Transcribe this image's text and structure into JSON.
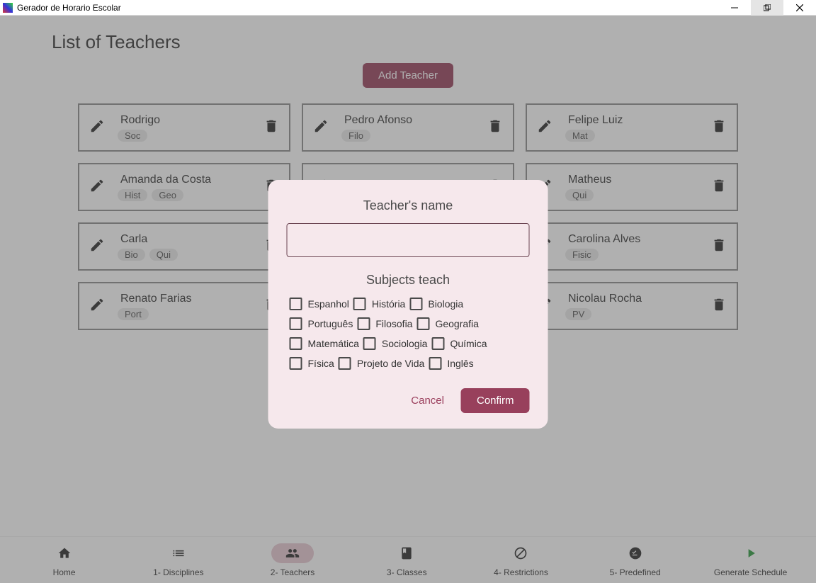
{
  "window": {
    "title": "Gerador de Horario Escolar"
  },
  "page": {
    "title": "List of Teachers",
    "add_teacher_label": "Add Teacher"
  },
  "teachers": [
    {
      "name": "Rodrigo",
      "tags": [
        "Soc"
      ]
    },
    {
      "name": "Pedro Afonso",
      "tags": [
        "Filo"
      ]
    },
    {
      "name": "Felipe Luiz",
      "tags": [
        "Mat"
      ]
    },
    {
      "name": "Amanda da Costa",
      "tags": [
        "Hist",
        "Geo"
      ]
    },
    {
      "name": "",
      "tags": []
    },
    {
      "name": "Matheus",
      "tags": [
        "Qui"
      ]
    },
    {
      "name": "Carla",
      "tags": [
        "Bio",
        "Qui"
      ]
    },
    {
      "name": "",
      "tags": []
    },
    {
      "name": "Carolina Alves",
      "tags": [
        "Fisic"
      ]
    },
    {
      "name": "Renato Farias",
      "tags": [
        "Port"
      ]
    },
    {
      "name": "",
      "tags": []
    },
    {
      "name": "Nicolau Rocha",
      "tags": [
        "PV"
      ]
    }
  ],
  "modal": {
    "name_label": "Teacher's name",
    "subjects_label": "Subjects teach",
    "name_value": "",
    "subjects": [
      "Espanhol",
      "História",
      "Biologia",
      "Português",
      "Filosofia",
      "Geografia",
      "Matemática",
      "Sociologia",
      "Química",
      "Física",
      "Projeto de Vida",
      "Inglês"
    ],
    "cancel_label": "Cancel",
    "confirm_label": "Confirm"
  },
  "nav": {
    "home": "Home",
    "disciplines": "1- Disciplines",
    "teachers": "2- Teachers",
    "classes": "3- Classes",
    "restrictions": "4- Restrictions",
    "predefined": "5- Predefined",
    "generate": "Generate Schedule"
  }
}
